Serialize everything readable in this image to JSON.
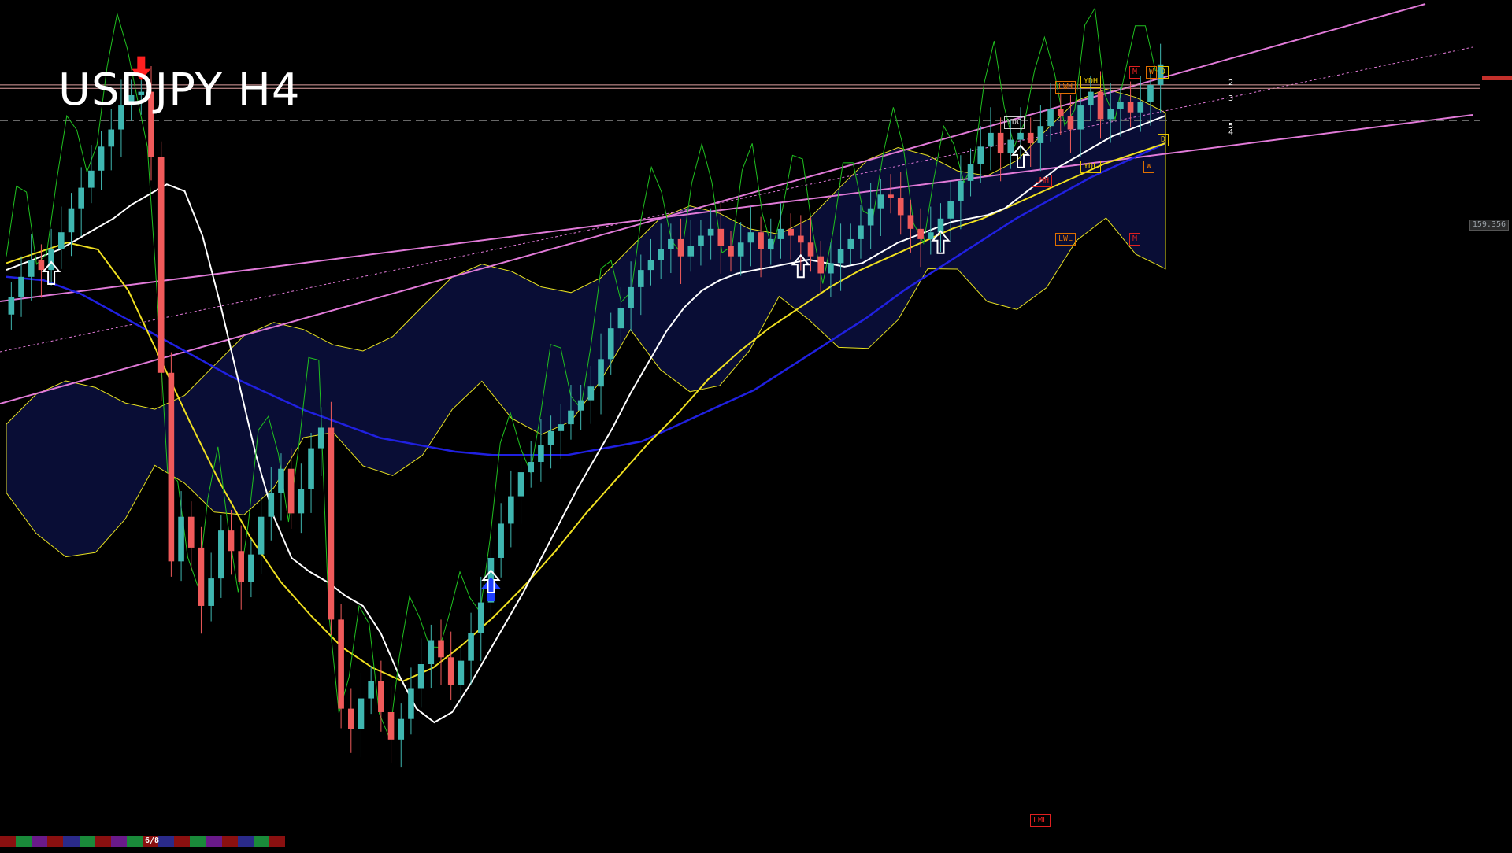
{
  "title": "USDJPY H4",
  "current_price_label": "159.356",
  "page_indicator": "6/8",
  "level_labels": [
    {
      "text": "YDH",
      "color": "#e6c300"
    },
    {
      "text": "LWH",
      "color": "#e07000"
    },
    {
      "text": "YDC",
      "color": "#cfcfcf"
    },
    {
      "text": "YDL",
      "color": "#e6c300"
    },
    {
      "text": "LMH",
      "color": "#e02020"
    },
    {
      "text": "LWL",
      "color": "#e07000"
    },
    {
      "text": "LML",
      "color": "#e02020"
    },
    {
      "text": "M",
      "color": "#e02020"
    },
    {
      "text": "W",
      "color": "#e07000"
    },
    {
      "text": "D",
      "color": "#e6c300"
    },
    {
      "text": "D",
      "color": "#e6c300"
    },
    {
      "text": "W",
      "color": "#e07000"
    },
    {
      "text": "M",
      "color": "#e02020"
    }
  ],
  "line_labels": [
    "2",
    "3",
    "5",
    "4"
  ],
  "colors": {
    "background": "#000000",
    "bull_candle": "#3fb6b0",
    "bear_candle": "#f05a5a",
    "channel": "#e17ad8",
    "ma_fast": "#ffffff",
    "ma_slow": "#f0e020",
    "ma_long": "#2020e0",
    "cloud": "#2030c0",
    "cloud_bear": "#c03030",
    "chikou": "#20c020",
    "signal_up": "#ffffff",
    "signal_down": "#ff2020",
    "signal_buy": "#2040ff"
  },
  "bottom_bar_colors": [
    "#8a1010",
    "#1a8a3a",
    "#6a1a8a",
    "#8a1010",
    "#2a2a8a",
    "#1a8a3a",
    "#8a1010",
    "#6a1a8a",
    "#1a8a3a",
    "#8a1010",
    "#2a2a8a",
    "#8a1010",
    "#1a8a3a",
    "#6a1a8a",
    "#8a1010",
    "#2a2a8a",
    "#1a8a3a",
    "#8a1010"
  ],
  "chart_data": {
    "type": "candlestick",
    "title": "USDJPY H4",
    "y_range": [
      139.0,
      161.5
    ],
    "closes": [
      154.2,
      154.8,
      155.3,
      155.0,
      155.6,
      156.1,
      156.8,
      157.4,
      157.9,
      158.6,
      159.1,
      159.8,
      160.1,
      160.2,
      158.3,
      152.0,
      146.5,
      147.8,
      146.9,
      145.2,
      146.0,
      147.4,
      146.8,
      145.9,
      146.7,
      147.8,
      148.5,
      149.2,
      147.9,
      148.6,
      149.8,
      150.4,
      144.8,
      142.2,
      141.6,
      142.5,
      143.0,
      142.1,
      141.3,
      141.9,
      142.8,
      143.5,
      144.2,
      143.7,
      142.9,
      143.6,
      144.4,
      145.3,
      146.6,
      147.6,
      148.4,
      149.1,
      149.4,
      149.9,
      150.3,
      150.5,
      150.9,
      151.2,
      151.6,
      152.4,
      153.3,
      153.9,
      154.5,
      155.0,
      155.3,
      155.6,
      155.9,
      155.4,
      155.7,
      156.0,
      156.2,
      155.7,
      155.4,
      155.8,
      156.1,
      155.6,
      155.9,
      156.2,
      156.0,
      155.8,
      155.4,
      154.9,
      155.2,
      155.6,
      155.9,
      156.3,
      156.8,
      157.2,
      157.1,
      156.6,
      156.2,
      155.9,
      156.1,
      156.5,
      157.0,
      157.6,
      158.1,
      158.6,
      159.0,
      158.4,
      158.8,
      159.0,
      158.7,
      159.2,
      159.7,
      159.5,
      159.1,
      159.8,
      160.2,
      159.4,
      159.7,
      159.9,
      159.6,
      159.9,
      160.4,
      161.0
    ],
    "ma_fast": [
      155.0,
      155.2,
      155.4,
      155.6,
      155.9,
      156.2,
      156.5,
      156.9,
      157.2,
      157.5,
      157.3,
      156.0,
      154.0,
      151.8,
      149.6,
      147.8,
      146.6,
      146.2,
      145.9,
      145.5,
      145.2,
      144.4,
      143.2,
      142.2,
      141.8,
      142.1,
      142.9,
      143.8,
      144.7,
      145.6,
      146.6,
      147.6,
      148.6,
      149.5,
      150.4,
      151.4,
      152.3,
      153.2,
      153.9,
      154.4,
      154.7,
      154.9,
      155.0,
      155.1,
      155.2,
      155.3,
      155.2,
      155.1,
      155.2,
      155.5,
      155.8,
      156.0,
      156.2,
      156.4,
      156.5,
      156.6,
      156.8,
      157.2,
      157.6,
      158.0,
      158.3,
      158.6,
      158.9,
      159.1,
      159.3,
      159.5
    ],
    "ma_slow": [
      155.2,
      155.5,
      155.8,
      155.6,
      154.4,
      152.5,
      150.6,
      148.8,
      147.2,
      145.9,
      144.9,
      144.0,
      143.4,
      143.0,
      143.4,
      144.1,
      144.9,
      145.8,
      146.8,
      147.9,
      148.9,
      149.9,
      150.8,
      151.8,
      152.6,
      153.3,
      153.9,
      154.5,
      155.0,
      155.4,
      155.8,
      156.2,
      156.5,
      156.9,
      157.3,
      157.7,
      158.1,
      158.4,
      158.7
    ],
    "ma_long": [
      154.8,
      154.7,
      154.3,
      153.7,
      153.1,
      152.5,
      151.9,
      151.4,
      150.9,
      150.5,
      150.1,
      149.9,
      149.7,
      149.6,
      149.6,
      149.6,
      149.8,
      150.0,
      150.5,
      151.0,
      151.5,
      152.2,
      152.9,
      153.6,
      154.4,
      155.1,
      155.8,
      156.5,
      157.1,
      157.7,
      158.2,
      158.7
    ],
    "horizontal_levels": [
      160.4,
      160.3,
      159.356
    ],
    "signals": [
      {
        "type": "up",
        "index": 4
      },
      {
        "type": "down",
        "index": 13
      },
      {
        "type": "buy",
        "index": 48
      },
      {
        "type": "up",
        "index": 48
      },
      {
        "type": "up",
        "index": 79
      },
      {
        "type": "up",
        "index": 93
      },
      {
        "type": "up",
        "index": 101
      }
    ]
  }
}
